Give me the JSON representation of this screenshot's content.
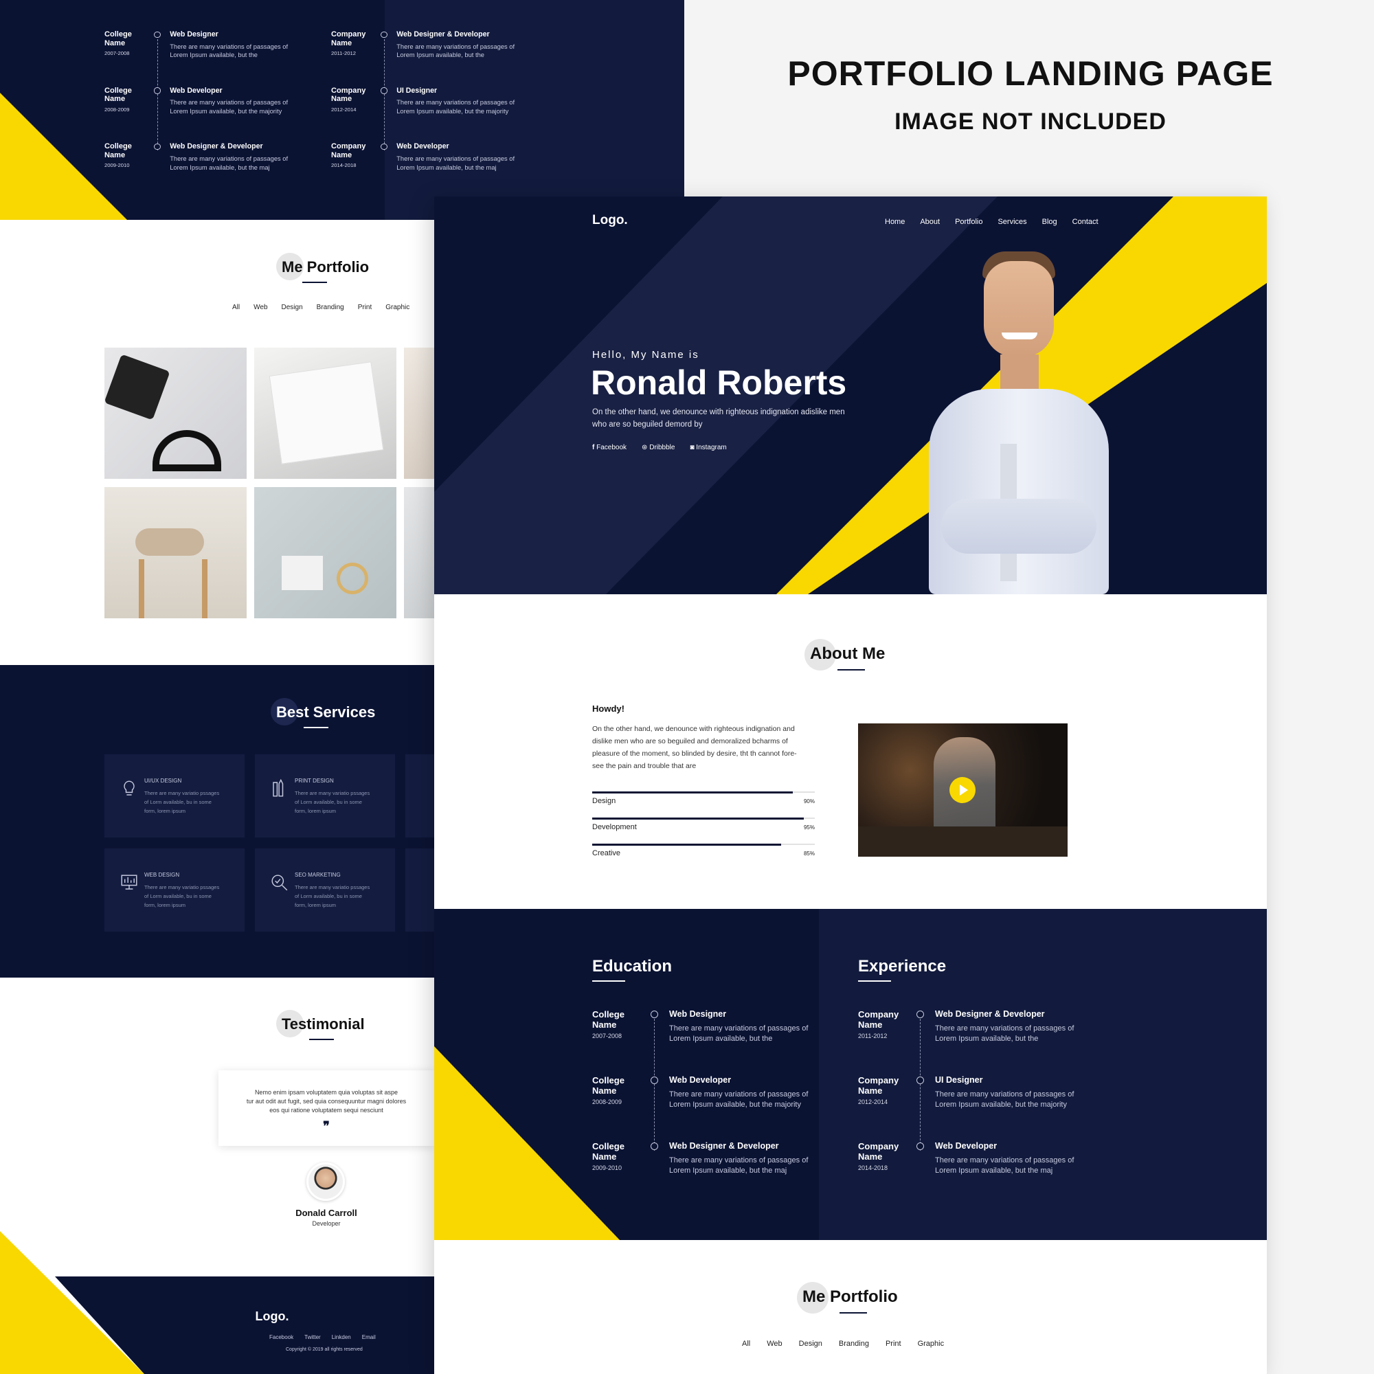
{
  "banner": {
    "title": "PORTFOLIO LANDING PAGE",
    "subtitle": "IMAGE NOT INCLUDED"
  },
  "nav": {
    "logo": "Logo.",
    "items": [
      "Home",
      "About",
      "Portfolio",
      "Services",
      "Blog",
      "Contact"
    ]
  },
  "hero": {
    "greeting": "Hello, My Name is",
    "name": "Ronald Roberts",
    "desc_line1": "On the other hand, we denounce with righteous indignation adislike men",
    "desc_line2": "who are so beguiled demord by",
    "social": [
      "Facebook",
      "Dribbble",
      "Instagram"
    ]
  },
  "about": {
    "title": "About Me",
    "howdy": "Howdy!",
    "para": [
      "On the other hand, we denounce with righteous indignation and",
      "dislike men who are so beguiled and demoralized bcharms of",
      "pleasure of the moment, so blinded by desire, tht th cannot fore-",
      "see the pain and trouble that are"
    ],
    "skills": [
      {
        "label": "Design",
        "pct": "90%",
        "value": 90
      },
      {
        "label": "Development",
        "pct": "95%",
        "value": 95
      },
      {
        "label": "Creative",
        "pct": "85%",
        "value": 85
      }
    ]
  },
  "education": {
    "title": "Education",
    "items": [
      {
        "org1": "College",
        "org2": "Name",
        "years": "2007-2008",
        "role": "Web Designer",
        "d1": "There are many variations of passages of",
        "d2": "Lorem Ipsum available, but the"
      },
      {
        "org1": "College",
        "org2": "Name",
        "years": "2008-2009",
        "role": "Web Developer",
        "d1": "There are many variations of passages of",
        "d2": "Lorem Ipsum available, but the majority"
      },
      {
        "org1": "College",
        "org2": "Name",
        "years": "2009-2010",
        "role": "Web Designer & Developer",
        "d1": "There are many variations of passages of",
        "d2": "Lorem Ipsum available, but the maj"
      }
    ]
  },
  "experience": {
    "title": "Experience",
    "items": [
      {
        "org1": "Company",
        "org2": "Name",
        "years": "2011-2012",
        "role": "Web Designer & Developer",
        "d1": "There are many variations of passages of",
        "d2": "Lorem Ipsum available, but the"
      },
      {
        "org1": "Company",
        "org2": "Name",
        "years": "2012-2014",
        "role": "UI Designer",
        "d1": "There are many variations of passages of",
        "d2": "Lorem Ipsum available, but the majority"
      },
      {
        "org1": "Company",
        "org2": "Name",
        "years": "2014-2018",
        "role": "Web  Developer",
        "d1": "There are many variations of passages of",
        "d2": "Lorem Ipsum available, but the maj"
      }
    ]
  },
  "portfolio": {
    "title": "Me Portfolio",
    "filters": [
      "All",
      "Web",
      "Design",
      "Branding",
      "Print",
      "Graphic"
    ]
  },
  "services": {
    "title": "Best Services",
    "items": [
      {
        "name": "UI/UX DESIGN",
        "d1": "There are many variatio pssages",
        "d2": "of Lorm available, bu in some",
        "d3": "form, lorem ipsum"
      },
      {
        "name": "PRINT DESIGN",
        "d1": "There are many variatio pssages",
        "d2": "of Lorm available, bu in some",
        "d3": "form, lorem ipsum"
      },
      {
        "name": "WEB DESIGN",
        "d1": "There are many variatio pssages",
        "d2": "of Lorm available, bu in some",
        "d3": "form, lorem ipsum"
      },
      {
        "name": "SEO MARKETING",
        "d1": "There are many variatio pssages",
        "d2": "of Lorm available, bu in some",
        "d3": "form, lorem ipsum"
      }
    ]
  },
  "testimonial": {
    "title": "Testimonial",
    "q1": "Nemo enim ipsam voluptatem quia voluptas sit aspe",
    "q2": "tur aut odit aut fugit, sed quia consequuntur magni dolores",
    "q3": "eos qui ratione voluptatem sequi nesciunt",
    "quote_mark": "❞",
    "name": "Donald Carroll",
    "role": "Developer"
  },
  "footer": {
    "logo": "Logo.",
    "links": [
      "Facebook",
      "Twitter",
      "Linkden",
      "Email"
    ],
    "copyright": "Copyright © 2019 all rights reserved"
  },
  "colors": {
    "navy": "#0b1333",
    "yellow": "#f8d800",
    "card": "#141d40"
  }
}
